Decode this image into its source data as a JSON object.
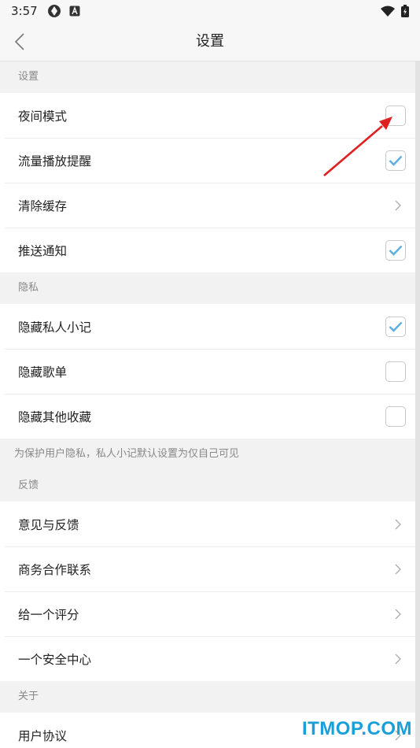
{
  "status_bar": {
    "time": "3:57"
  },
  "header": {
    "title": "设置"
  },
  "sections": {
    "settings": {
      "title": "设置",
      "rows": [
        {
          "label": "夜间模式",
          "checked": false
        },
        {
          "label": "流量播放提醒",
          "checked": true
        },
        {
          "label": "清除缓存"
        },
        {
          "label": "推送通知",
          "checked": true
        }
      ]
    },
    "privacy": {
      "title": "隐私",
      "rows": [
        {
          "label": "隐藏私人小记",
          "checked": true
        },
        {
          "label": "隐藏歌单",
          "checked": false
        },
        {
          "label": "隐藏其他收藏",
          "checked": false
        }
      ],
      "note": "为保护用户隐私，私人小记默认设置为仅自己可见"
    },
    "feedback": {
      "title": "反馈",
      "rows": [
        {
          "label": "意见与反馈"
        },
        {
          "label": "商务合作联系"
        },
        {
          "label": "给一个评分"
        },
        {
          "label": "一个安全中心"
        }
      ]
    },
    "about": {
      "title": "关于",
      "rows": [
        {
          "label": "用户协议"
        }
      ]
    }
  },
  "watermark": "ITMOP.COM",
  "colors": {
    "check": "#5aaee0",
    "arrow": "#e02020",
    "watermark": "#1a9fd8"
  }
}
